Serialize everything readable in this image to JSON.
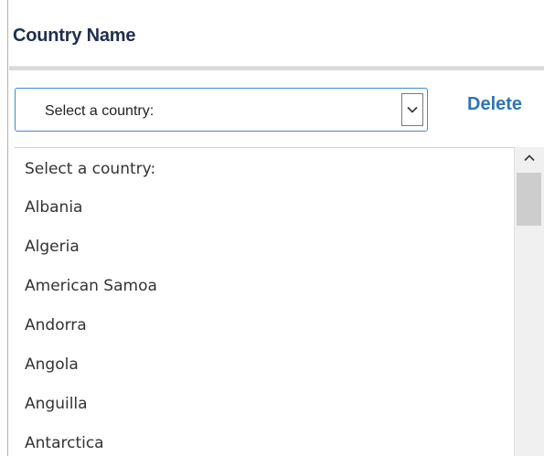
{
  "header": {
    "title": "Country Name"
  },
  "select": {
    "value": "Select a country:",
    "arrow_icon": "chevron-down-icon"
  },
  "actions": {
    "delete_label": "Delete"
  },
  "dropdown": {
    "options": [
      "Select a country:",
      "Albania",
      "Algeria",
      "American Samoa",
      "Andorra",
      "Angola",
      "Anguilla",
      "Antarctica"
    ],
    "scroll_up_icon": "chevron-up-icon"
  },
  "colors": {
    "accent": "#3f8ccf",
    "link": "#2f74b5",
    "title": "#1f2e4d"
  }
}
